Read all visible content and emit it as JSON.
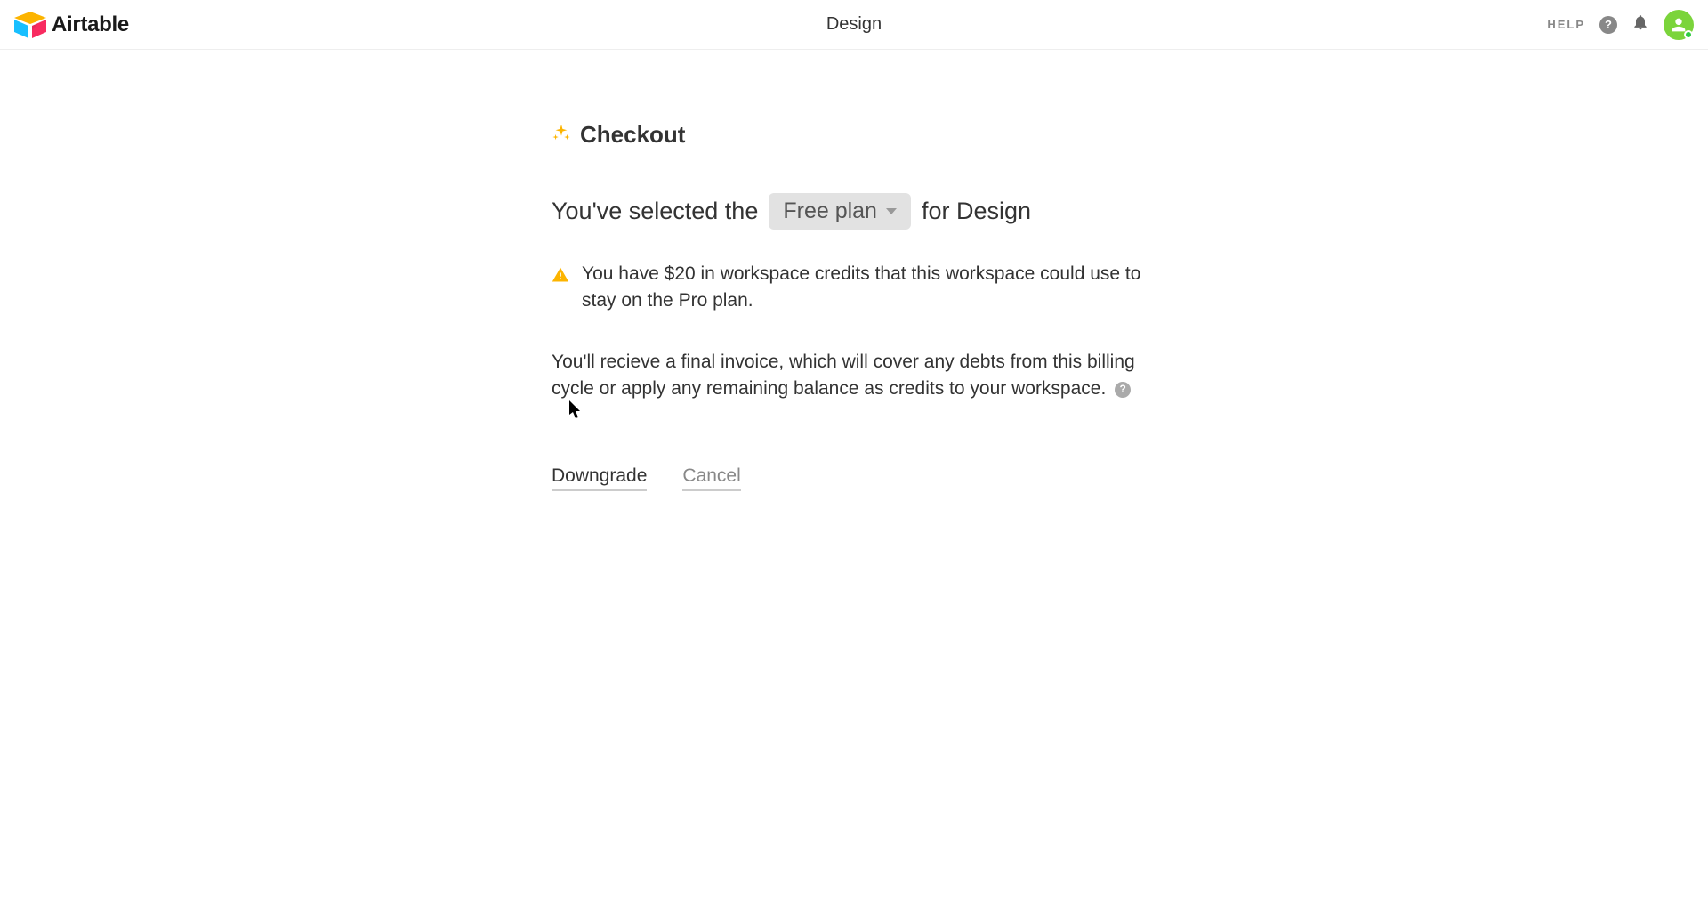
{
  "header": {
    "brand": "Airtable",
    "workspace_title": "Design",
    "help_label": "HELP"
  },
  "checkout": {
    "title": "Checkout",
    "selection_prefix": "You've selected the",
    "selected_plan": "Free plan",
    "selection_suffix": "for Design",
    "warning_message": "You have $20 in workspace credits that this workspace could use to stay on the Pro plan.",
    "info_message": "You'll recieve a final invoice, which will cover any debts from this billing cycle or apply any remaining balance as credits to your workspace.",
    "actions": {
      "primary": "Downgrade",
      "secondary": "Cancel"
    }
  }
}
